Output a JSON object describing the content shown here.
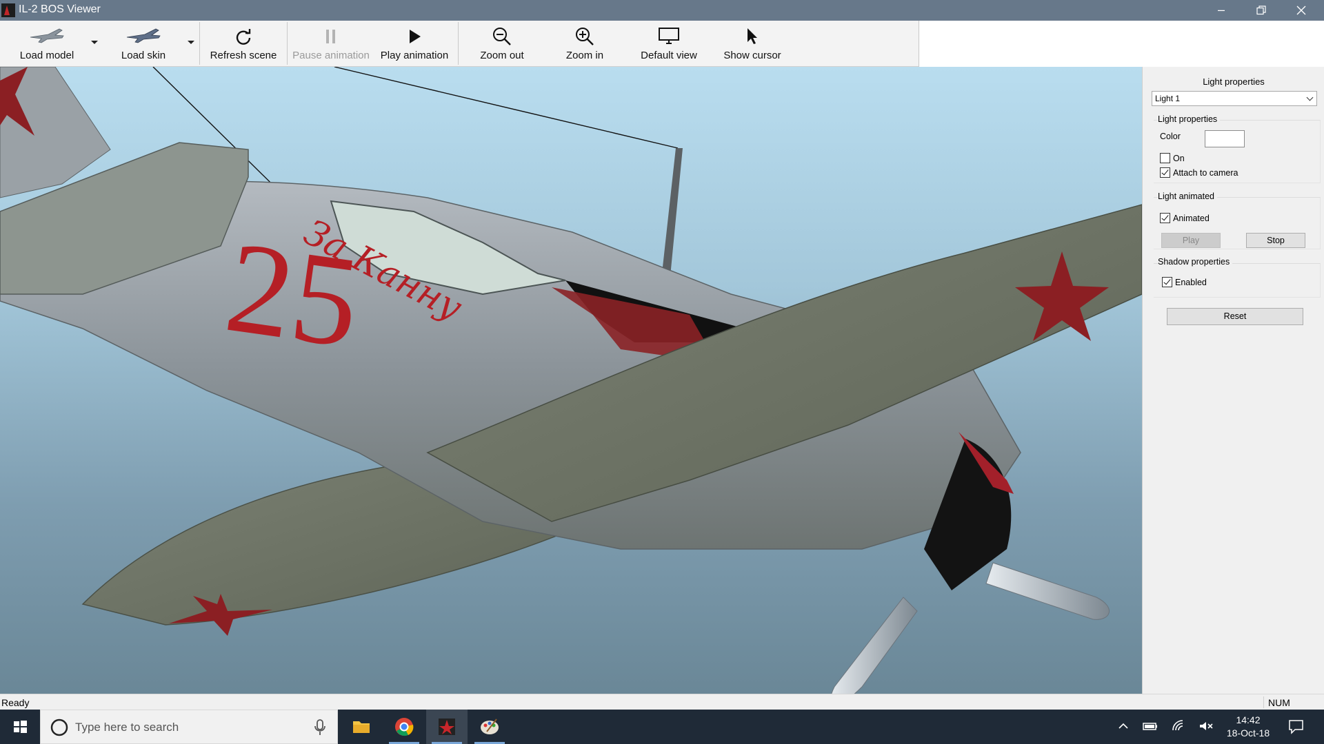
{
  "window": {
    "title": "IL-2 BOS Viewer"
  },
  "toolbar": {
    "load_model": "Load model",
    "load_skin": "Load skin",
    "refresh_scene": "Refresh scene",
    "pause_animation": "Pause animation",
    "play_animation": "Play animation",
    "zoom_out": "Zoom out",
    "zoom_in": "Zoom in",
    "default_view": "Default view",
    "show_cursor": "Show cursor"
  },
  "viewport": {
    "aircraft_number": "25",
    "aircraft_inscription": "За Канну"
  },
  "panel": {
    "title": "Light properties",
    "light_select": "Light 1",
    "light_group": {
      "label": "Light properties",
      "color_label": "Color",
      "color_value": "#ffffff",
      "on_label": "On",
      "on_checked": false,
      "attach_label": "Attach to camera",
      "attach_checked": true
    },
    "animated_group": {
      "label": "Light animated",
      "animated_label": "Animated",
      "animated_checked": true,
      "play_label": "Play",
      "stop_label": "Stop"
    },
    "shadow_group": {
      "label": "Shadow properties",
      "enabled_label": "Enabled",
      "enabled_checked": true
    },
    "reset_label": "Reset"
  },
  "statusbar": {
    "status": "Ready",
    "num_indicator": "NUM"
  },
  "taskbar": {
    "search_placeholder": "Type here to search",
    "time": "14:42",
    "date": "18-Oct-18"
  }
}
